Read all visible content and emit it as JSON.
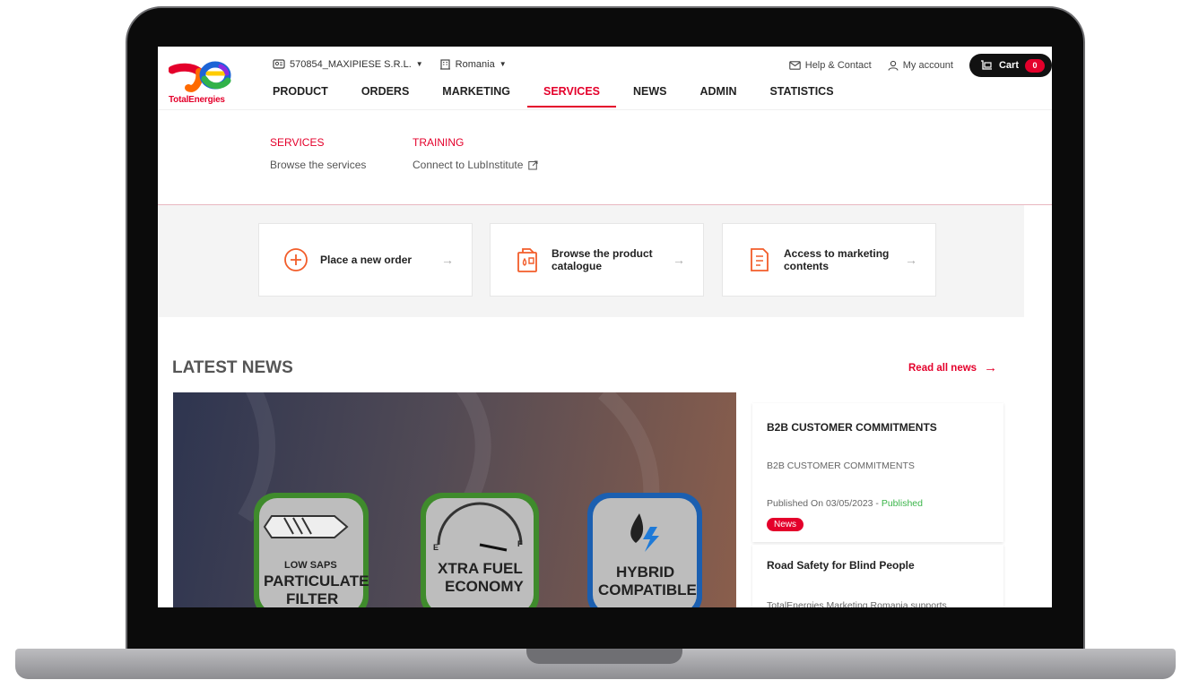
{
  "brand": {
    "name": "TotalEnergies",
    "accent": "#e4002b"
  },
  "header": {
    "account_selector": "570854_MAXIPIESE S.R.L.",
    "country_selector": "Romania",
    "help_label": "Help & Contact",
    "account_label": "My account",
    "cart_label": "Cart",
    "cart_count": "0"
  },
  "nav": {
    "items": [
      {
        "label": "PRODUCT"
      },
      {
        "label": "ORDERS"
      },
      {
        "label": "MARKETING"
      },
      {
        "label": "SERVICES"
      },
      {
        "label": "NEWS"
      },
      {
        "label": "ADMIN"
      },
      {
        "label": "STATISTICS"
      }
    ],
    "active": "SERVICES"
  },
  "dropdown": {
    "columns": [
      {
        "title": "SERVICES",
        "link": "Browse the services"
      },
      {
        "title": "TRAINING",
        "link": "Connect to LubInstitute"
      }
    ]
  },
  "quick_actions": [
    {
      "label": "Place a new order",
      "icon": "plus-circle-icon"
    },
    {
      "label_line1": "Browse the product",
      "label_line2": "catalogue",
      "icon": "oil-can-icon"
    },
    {
      "label_line1": "Access to marketing",
      "label_line2": "contents",
      "icon": "document-icon"
    }
  ],
  "news": {
    "heading": "LATEST NEWS",
    "read_all": "Read all news",
    "hero_badges": [
      {
        "line1": "LOW SAPS",
        "line2": "PARTICULATE",
        "line3": "FILTER"
      },
      {
        "line1": "XTRA FUEL",
        "line2": "ECONOMY"
      },
      {
        "line1": "HYBRID",
        "line2": "COMPATIBLE"
      }
    ],
    "gauge_marks": {
      "empty": "E",
      "full": "F"
    },
    "cards": [
      {
        "title": "B2B CUSTOMER COMMITMENTS",
        "description": "B2B CUSTOMER COMMITMENTS",
        "published_prefix": "Published On 03/05/2023 - ",
        "status": "Published",
        "tag": "News"
      },
      {
        "title": "Road Safety for Blind People",
        "description": "TotalEnergies Marketing Romania supports"
      }
    ]
  }
}
